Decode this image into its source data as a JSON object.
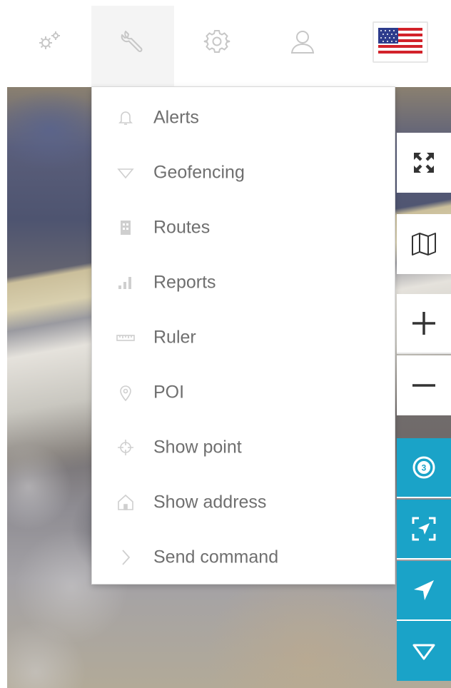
{
  "toolbar": {
    "items": [
      {
        "icon": "gears-icon"
      },
      {
        "icon": "wrench-icon",
        "active": true
      },
      {
        "icon": "settings-icon"
      },
      {
        "icon": "user-icon"
      }
    ],
    "language": {
      "icon": "us-flag-icon"
    }
  },
  "tools_menu": {
    "items": [
      {
        "label": "Alerts",
        "icon": "bell-icon"
      },
      {
        "label": "Geofencing",
        "icon": "triangle-down-icon"
      },
      {
        "label": "Routes",
        "icon": "route-icon"
      },
      {
        "label": "Reports",
        "icon": "bar-chart-icon"
      },
      {
        "label": "Ruler",
        "icon": "ruler-icon"
      },
      {
        "label": "POI",
        "icon": "map-pin-icon"
      },
      {
        "label": "Show point",
        "icon": "crosshair-icon"
      },
      {
        "label": "Show address",
        "icon": "house-icon"
      },
      {
        "label": "Send command",
        "icon": "chevron-right-icon"
      }
    ]
  },
  "map_controls": {
    "fullscreen": {
      "icon": "fullscreen-icon"
    },
    "map_layers": {
      "icon": "map-icon"
    },
    "zoom_in": {
      "icon": "plus-icon"
    },
    "zoom_out": {
      "icon": "minus-icon"
    },
    "history": {
      "icon": "history-badge-icon",
      "badge": "3"
    },
    "fit_objects": {
      "icon": "fit-bounds-icon"
    },
    "follow": {
      "icon": "navigation-arrow-icon"
    },
    "geofence": {
      "icon": "geofence-triangle-icon"
    }
  },
  "colors": {
    "accent": "#1aa3c8",
    "menu_text": "#6f6f6f",
    "menu_icon": "#cfcfcf",
    "toolbar_icon": "#c7c7c7"
  }
}
